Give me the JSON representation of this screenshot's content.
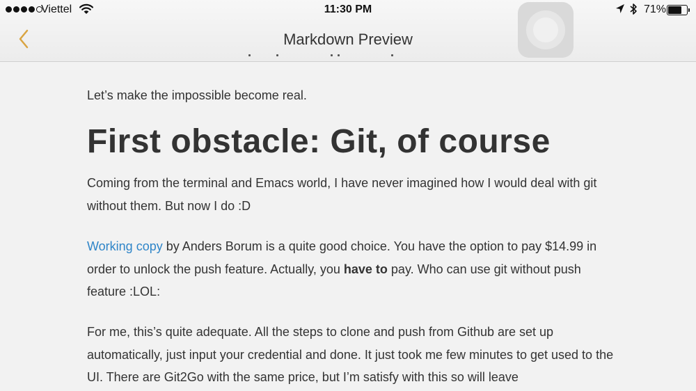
{
  "status_bar": {
    "carrier": "Viettel",
    "time": "11:30 PM",
    "battery_percent": "71%",
    "battery_level": 0.71,
    "signal_bars_filled": 4,
    "signal_bars_total": 5
  },
  "nav": {
    "title": "Markdown Preview"
  },
  "article": {
    "intro": "Let’s make the impossible become real.",
    "heading": "First obstacle: Git, of course",
    "p1": "Coming from the terminal and Emacs world, I have never imagined how I would deal with git without them. But now I do :D",
    "p2": {
      "link_text": "Working copy",
      "text_a": " by Anders Borum is a quite good choice. You have the option to pay $14.99 in order to unlock the push feature. Actually, you ",
      "bold": "have to",
      "text_b": " pay. Who can use git without push feature :LOL:"
    },
    "p3": "For me, this’s quite adequate. All the steps to clone and push from Github are set up automatically, just input your credential and done. It just took me few minutes to get used to the UI. There are Git2Go with the same price, but I’m satisfy with this so will leave"
  },
  "colors": {
    "accent": "#d9a441",
    "link": "#2f85c8",
    "text": "#333333",
    "background": "#f2f2f2"
  },
  "icons": {
    "back": "chevron-left-icon",
    "wifi": "wifi-icon",
    "location": "location-arrow-icon",
    "bluetooth": "bluetooth-icon",
    "battery": "battery-icon",
    "assistive_touch": "assistive-touch-icon"
  }
}
